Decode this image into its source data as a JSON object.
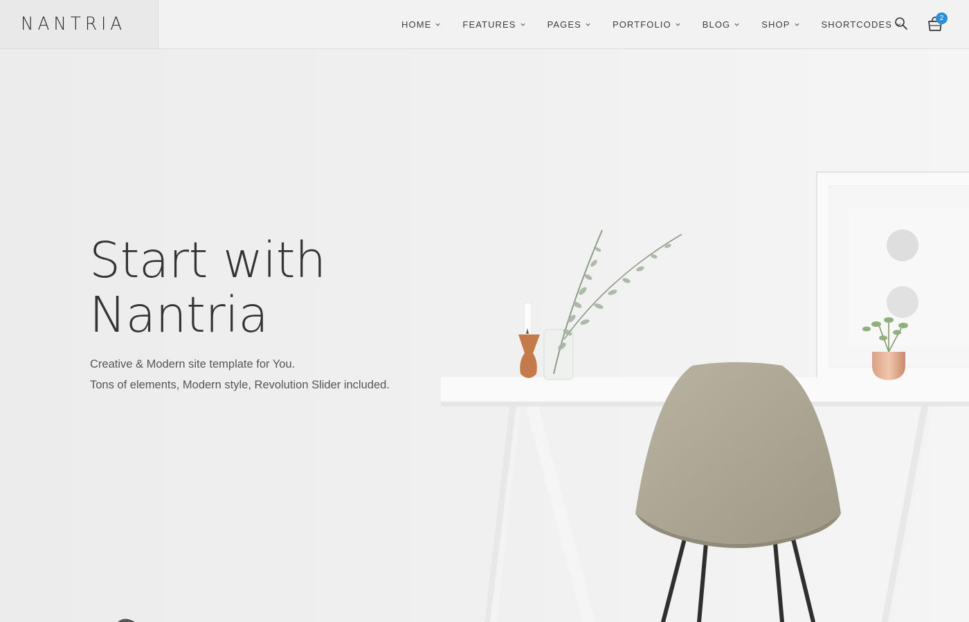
{
  "brand": {
    "logo_text": "NANTRIA"
  },
  "nav": {
    "items": [
      {
        "label": "HOME"
      },
      {
        "label": "FEATURES"
      },
      {
        "label": "PAGES"
      },
      {
        "label": "PORTFOLIO"
      },
      {
        "label": "BLOG"
      },
      {
        "label": "SHOP"
      },
      {
        "label": "SHORTCODES"
      }
    ],
    "search_icon": "search-icon",
    "cart_icon": "shopping-bag-icon",
    "cart_count": "2"
  },
  "hero": {
    "title_line1": "Start with",
    "title_line2": "Nantria",
    "subtitle_line1": "Creative & Modern site template for You.",
    "subtitle_line2": "Tons of elements, Modern style, Revolution Slider included."
  },
  "colors": {
    "accent": "#2b8fd8",
    "text_dark": "#333333",
    "background": "#f0f0f0"
  }
}
